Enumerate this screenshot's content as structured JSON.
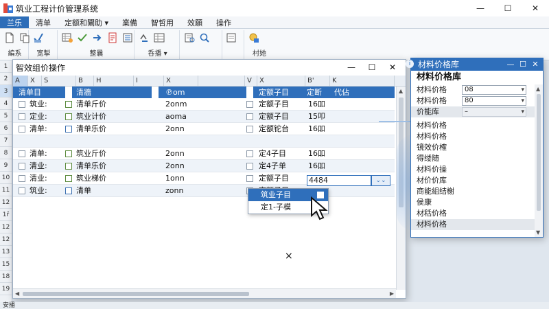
{
  "app": {
    "title": "筑业工程计价管理系统",
    "controls": {
      "minimize": "—",
      "maximize": "☐",
      "close": "✕"
    }
  },
  "menu": {
    "items": [
      {
        "label": "兰乐",
        "active": true
      },
      {
        "label": "清单",
        "active": false
      },
      {
        "label": "定额和闡助 ▾",
        "active": false
      },
      {
        "label": "業備",
        "active": false
      },
      {
        "label": "智哲用",
        "active": false
      },
      {
        "label": "效願",
        "active": false
      },
      {
        "label": "操作",
        "active": false
      }
    ]
  },
  "ribbon": {
    "groups": [
      {
        "label": "編系"
      },
      {
        "label": "宽掣"
      },
      {
        "label": "整曩"
      },
      {
        "label": "呑播 ▾"
      },
      {
        "label": ""
      },
      {
        "label": "村她"
      }
    ]
  },
  "left_rows": [
    "1",
    "2",
    "3",
    "4",
    "5",
    "6",
    "7",
    "8",
    "9",
    "10",
    "11",
    "12",
    "1ř",
    "12",
    "12",
    "13",
    "15",
    "18",
    "19",
    "1ŕ"
  ],
  "status": {
    "text": "安播"
  },
  "dialog": {
    "title": "智效组价操作",
    "controls": {
      "minimize": "—",
      "maximize": "☐",
      "close": "✕"
    },
    "col_letters": [
      "A",
      "X",
      "S",
      "B",
      "H",
      "I",
      "X",
      "",
      "V",
      "X",
      "B'",
      "X",
      "I'",
      "K"
    ],
    "header": {
      "c1": "清单目",
      "c2": "清牆",
      "c3": "℗om",
      "c4": "定额子目",
      "c5": "定断",
      "c6": "代佔"
    },
    "rows": [
      {
        "a": "筑业:",
        "b": "清单斤价",
        "c": "2onm",
        "d": "定额子目",
        "e": "16吅",
        "alt": false
      },
      {
        "a": "定业:",
        "b": "筑业计价",
        "c": "aoma",
        "d": "定额子目",
        "e": "15叩",
        "alt": true
      },
      {
        "a": "清单:",
        "b": "清单乐价",
        "c": "2onn",
        "d": "定额铊台",
        "e": "16吅",
        "alt": false
      },
      {
        "a": "",
        "b": "",
        "c": "",
        "d": "",
        "e": "",
        "alt": true
      },
      {
        "a": "清单:",
        "b": "筑业斤价",
        "c": "2onn",
        "d": "定4子目",
        "e": "16吅",
        "alt": false
      },
      {
        "a": "清业:",
        "b": "清单乐价",
        "c": "2onn",
        "d": "定4子单",
        "e": "16吅",
        "alt": true
      },
      {
        "a": "清业:",
        "b": "筑业梯价",
        "c": "1onn",
        "d": "定额子目",
        "e": "16吅",
        "alt": false
      },
      {
        "a": "筑业:",
        "b": "清单",
        "c": "zonn",
        "d": "定额子目",
        "e": "",
        "alt": true
      }
    ],
    "edit_value": "4484",
    "edit_button": "⌄⌄",
    "dropdown": {
      "options": [
        "筑业子目",
        "定1-子模"
      ]
    },
    "close_mark": "×"
  },
  "panel": {
    "title": "材料价格库",
    "info": "i",
    "controls": {
      "minimize": "—",
      "maximize": "☐",
      "close": "✕"
    },
    "subtitle": "材料价格库",
    "fields": [
      {
        "label": "材料价格",
        "value": "08"
      },
      {
        "label": "材料价格",
        "value": "80"
      },
      {
        "label": "价能库",
        "value": "–"
      }
    ],
    "list": [
      "材料价格",
      "材料价格",
      "镜效价榷",
      "得缕随",
      "材料价操",
      "材价价库",
      "商能組结榭",
      "侯康",
      "材秳价格",
      "材料价格"
    ]
  },
  "colors": {
    "accent": "#2f6fbb",
    "header_bg": "#2f6fbb",
    "menu_active": "#2d6db8"
  }
}
